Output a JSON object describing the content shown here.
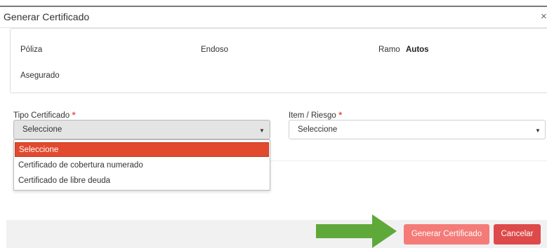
{
  "modal": {
    "title": "Generar Certificado",
    "close_icon": "close-icon",
    "close_glyph": "×"
  },
  "info": {
    "poliza_label": "Póliza",
    "endoso_label": "Endoso",
    "ramo_label": "Ramo",
    "ramo_value": "Autos",
    "asegurado_label": "Asegurado"
  },
  "form": {
    "tipo_label": "Tipo Certificado",
    "tipo_selected": "Seleccione",
    "item_label": "Item / Riesgo",
    "item_selected": "Seleccione",
    "required_mark": "*",
    "caret_glyph": "▼",
    "dropdown_options": [
      "Seleccione",
      "Certificado de cobertura numerado",
      "Certificado de libre deuda"
    ]
  },
  "footer": {
    "generate_label": "Generar Certificado",
    "cancel_label": "Cancelar"
  },
  "colors": {
    "selected_option": "#e14a2f",
    "generate_button": "#f47b78",
    "cancel_button": "#de4a4a",
    "arrow": "#5fa83a",
    "required": "#e0271c"
  }
}
